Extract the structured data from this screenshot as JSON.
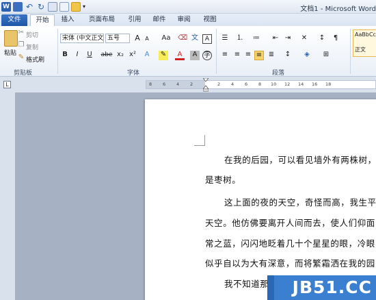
{
  "window": {
    "title": "文档1 - Microsoft Word"
  },
  "quick_access": {
    "icons": [
      "word-icon",
      "save-icon",
      "undo-icon",
      "redo-icon",
      "print-preview-icon",
      "email-icon",
      "folder-icon",
      "customize-icon"
    ]
  },
  "tabs": [
    "文件",
    "开始",
    "插入",
    "页面布局",
    "引用",
    "邮件",
    "审阅",
    "视图"
  ],
  "clipboard": {
    "cut": "剪切",
    "copy": "复制",
    "paste": "粘贴",
    "format_painter": "格式刷",
    "group": "剪贴板"
  },
  "font": {
    "name": "宋体 (中文正文)",
    "size": "五号",
    "group": "字体",
    "bold": "B",
    "italic": "I",
    "underline": "U",
    "strike": "abe",
    "sub": "x₂",
    "sup": "x²",
    "grow": "A",
    "shrink": "A",
    "case": "Aa",
    "clear": "A"
  },
  "paragraph": {
    "group": "段落"
  },
  "styles": {
    "preview": "AaBbCc",
    "name": "正文"
  },
  "ruler": {
    "ticks": [
      "8",
      "6",
      "4",
      "2",
      "2",
      "4",
      "6",
      "8",
      "10",
      "12",
      "14",
      "16",
      "18"
    ]
  },
  "document": {
    "lines": [
      "在我的后园，可以看见墙外有两株树，",
      "是枣树。",
      "这上面的夜的天空，奇怪而高，我生平",
      "天空。他仿佛要离开人间而去，使人们仰面",
      "常之蓝，闪闪地眨着几十个星星的眼，冷眼",
      "似乎自以为大有深意，而将繁霜洒在我的园",
      "我不知道那"
    ]
  },
  "watermark": {
    "text": "JB51.CC"
  },
  "colors": {
    "file_tab": "#2b62b3",
    "watermark": "#3a7fd0",
    "highlight": "#f6d36b"
  }
}
